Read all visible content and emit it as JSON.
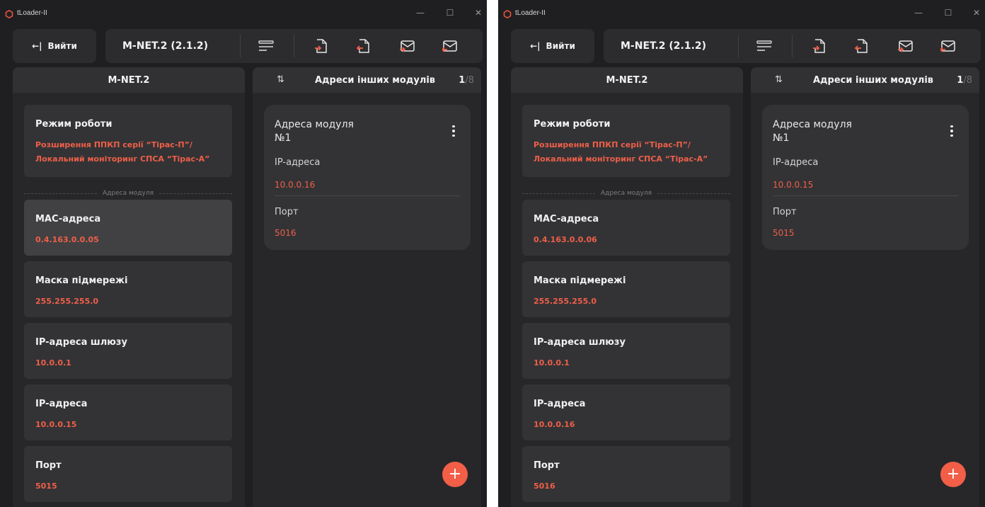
{
  "windows": [
    {
      "title": "tLoader-II",
      "controls": {
        "minimize": "—",
        "maximize": "☐",
        "close": "✕"
      },
      "toolbar": {
        "exit_arrow": "←|",
        "exit_label": "Вийти",
        "device_title": "M-NET.2 (2.1.2)",
        "icons": [
          "list-icon",
          "file-download-icon",
          "file-upload-icon",
          "mail-download-icon",
          "mail-upload-icon"
        ]
      },
      "left_panel": {
        "header": "M-NET.2",
        "mode_card": {
          "title": "Режим роботи",
          "value_line1": "Розширення ППКП серії “Тірас-П”/",
          "value_line2": "Локальний моніторинг СПСА “Тірас-А”"
        },
        "section_label": "Адреса модуля",
        "cards": [
          {
            "title": "MAC-адреса",
            "value": "0.4.163.0.0.05"
          },
          {
            "title": "Маска підмережі",
            "value": "255.255.255.0"
          },
          {
            "title": "IP-адреса шлюзу",
            "value": "10.0.0.1"
          },
          {
            "title": "IP-адреса",
            "value": "10.0.0.15"
          },
          {
            "title": "Порт",
            "value": "5015"
          }
        ]
      },
      "right_panel": {
        "sort_icon": "⇅",
        "header": "Адреси інших модулів",
        "page_current": "1",
        "page_total": "/8",
        "module": {
          "title_line1": "Адреса модуля",
          "title_line2": "№1",
          "ip_label": "IP-адреса",
          "ip_value": "10.0.0.16",
          "port_label": "Порт",
          "port_value": "5016"
        },
        "add_button": "+"
      }
    },
    {
      "title": "tLoader-II",
      "controls": {
        "minimize": "—",
        "maximize": "☐",
        "close": "✕"
      },
      "toolbar": {
        "exit_arrow": "←|",
        "exit_label": "Вийти",
        "device_title": "M-NET.2 (2.1.2)",
        "icons": [
          "list-icon",
          "file-download-icon",
          "file-upload-icon",
          "mail-download-icon",
          "mail-upload-icon"
        ]
      },
      "left_panel": {
        "header": "M-NET.2",
        "mode_card": {
          "title": "Режим роботи",
          "value_line1": "Розширення ППКП серії “Тірас-П”/",
          "value_line2": "Локальний моніторинг СПСА “Тірас-А”"
        },
        "section_label": "Адреса модуля",
        "cards": [
          {
            "title": "MAC-адреса",
            "value": "0.4.163.0.0.06"
          },
          {
            "title": "Маска підмережі",
            "value": "255.255.255.0"
          },
          {
            "title": "IP-адреса шлюзу",
            "value": "10.0.0.1"
          },
          {
            "title": "IP-адреса",
            "value": "10.0.0.16"
          },
          {
            "title": "Порт",
            "value": "5016"
          }
        ]
      },
      "right_panel": {
        "sort_icon": "⇅",
        "header": "Адреси інших модулів",
        "page_current": "1",
        "page_total": "/8",
        "module": {
          "title_line1": "Адреса модуля",
          "title_line2": "№1",
          "ip_label": "IP-адреса",
          "ip_value": "10.0.0.15",
          "port_label": "Порт",
          "port_value": "5015"
        },
        "add_button": "+"
      }
    }
  ],
  "colors": {
    "background": "#1f1f21",
    "surface": "#27272a",
    "card": "#333336",
    "card_selected": "#414144",
    "accent": "#ef5f48",
    "fab": "#f25e47"
  }
}
